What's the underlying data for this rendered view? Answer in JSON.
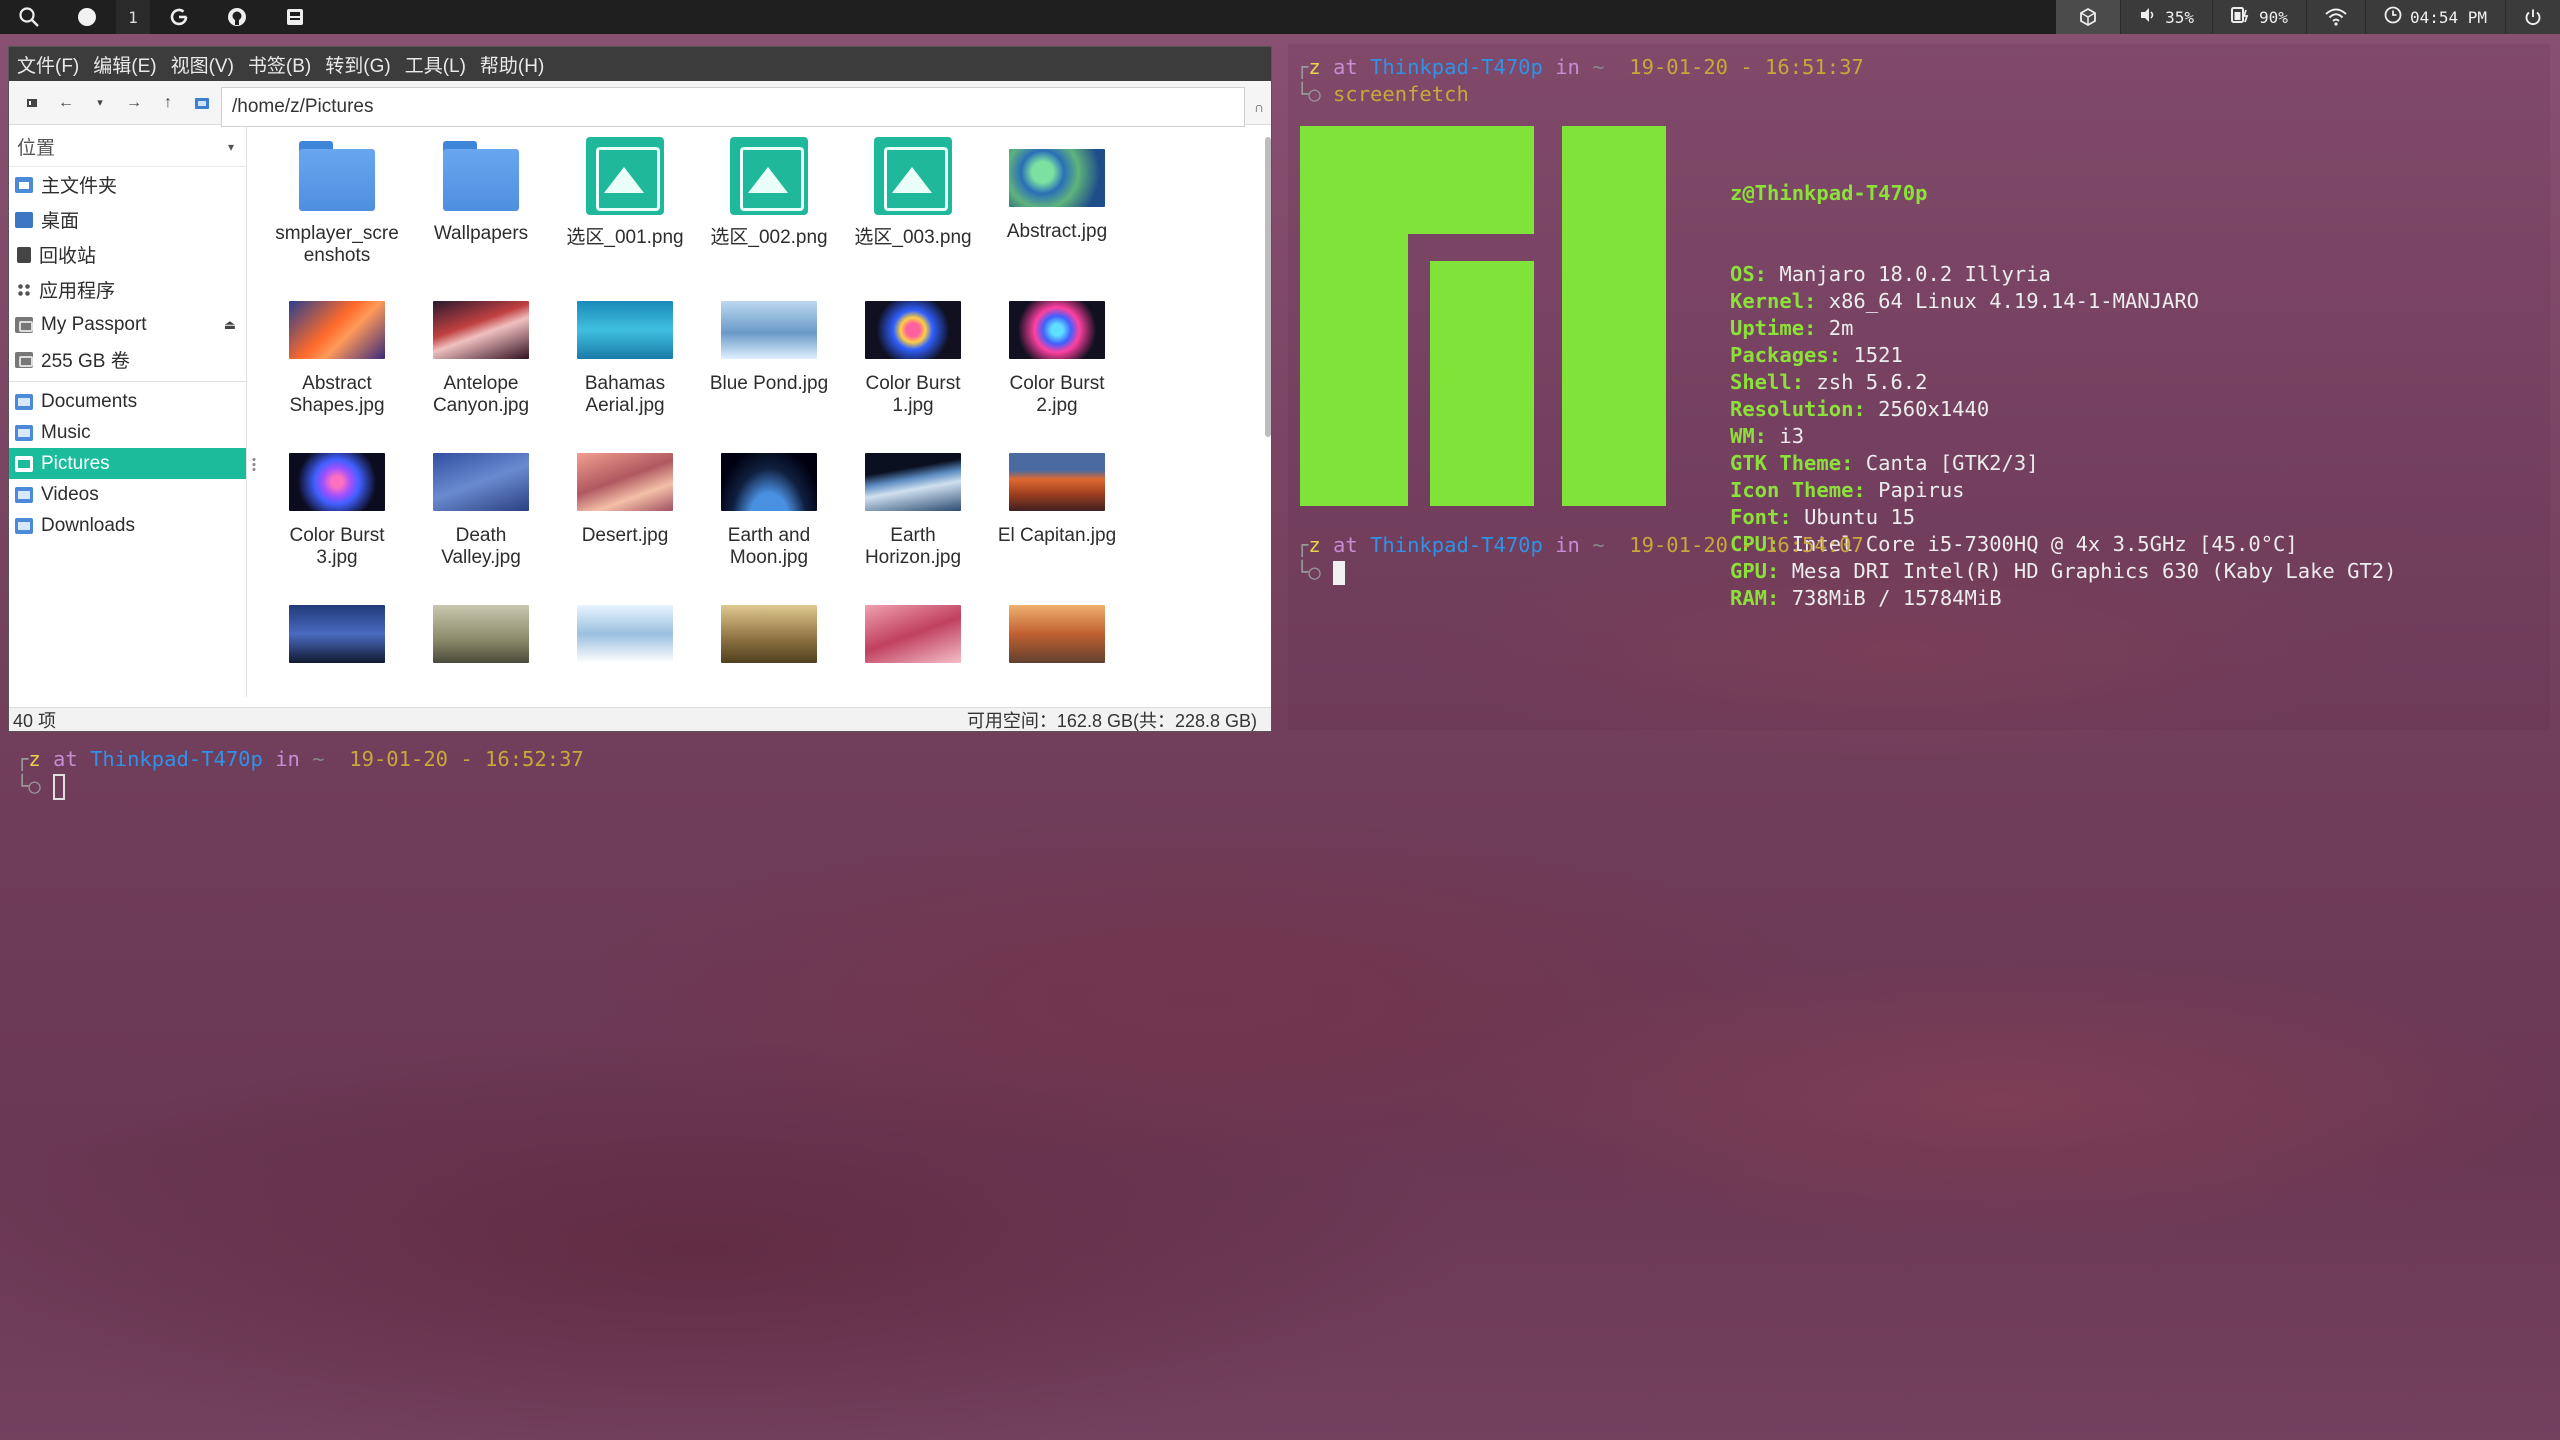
{
  "topbar": {
    "workspace_number": "1",
    "status": {
      "volume": "35%",
      "battery": "90%",
      "clock": "04:54 PM"
    }
  },
  "file_manager": {
    "menus": [
      "文件(F)",
      "编辑(E)",
      "视图(V)",
      "书签(B)",
      "转到(G)",
      "工具(L)",
      "帮助(H)"
    ],
    "path": "/home/z/Pictures",
    "sidebar_header": "位置",
    "places": [
      {
        "label": "主文件夹",
        "icon": "home-icon"
      },
      {
        "label": "桌面",
        "icon": "desktop-icon"
      },
      {
        "label": "回收站",
        "icon": "trash-icon"
      },
      {
        "label": "应用程序",
        "icon": "apps-icon"
      },
      {
        "label": "My Passport",
        "icon": "drive-icon"
      },
      {
        "label": "255 GB 卷",
        "icon": "drive-icon"
      }
    ],
    "bookmarks": [
      {
        "label": "Documents"
      },
      {
        "label": "Music"
      },
      {
        "label": "Pictures"
      },
      {
        "label": "Videos"
      },
      {
        "label": "Downloads"
      }
    ],
    "selected_bookmark": "Pictures",
    "files": [
      {
        "name": "smplayer_scre\nenshots",
        "kind": "folder"
      },
      {
        "name": "Wallpapers",
        "kind": "folder"
      },
      {
        "name": "选区_001.png",
        "kind": "png"
      },
      {
        "name": "选区_002.png",
        "kind": "png"
      },
      {
        "name": "选区_003.png",
        "kind": "png"
      },
      {
        "name": "Abstract.jpg",
        "kind": "img"
      },
      {
        "name": "Abstract\nShapes.jpg",
        "kind": "img"
      },
      {
        "name": "Antelope\nCanyon.jpg",
        "kind": "img"
      },
      {
        "name": "Bahamas\nAerial.jpg",
        "kind": "img"
      },
      {
        "name": "Blue Pond.jpg",
        "kind": "img"
      },
      {
        "name": "Color Burst\n1.jpg",
        "kind": "img"
      },
      {
        "name": "Color Burst\n2.jpg",
        "kind": "img"
      },
      {
        "name": "Color Burst\n3.jpg",
        "kind": "img"
      },
      {
        "name": "Death\nValley.jpg",
        "kind": "img"
      },
      {
        "name": "Desert.jpg",
        "kind": "img"
      },
      {
        "name": "Earth and\nMoon.jpg",
        "kind": "img"
      },
      {
        "name": "Earth\nHorizon.jpg",
        "kind": "img"
      },
      {
        "name": "El Capitan.jpg",
        "kind": "img"
      },
      {
        "name": "",
        "kind": "img"
      },
      {
        "name": "",
        "kind": "img"
      },
      {
        "name": "",
        "kind": "img"
      },
      {
        "name": "",
        "kind": "img"
      },
      {
        "name": "",
        "kind": "img"
      },
      {
        "name": "",
        "kind": "img"
      }
    ],
    "status_count": "40 项",
    "status_space": "可用空间：162.8 GB(共：228.8 GB)"
  },
  "terminal_top": {
    "prompt1": {
      "user": "z",
      "at": "at",
      "host": "Thinkpad-T470p",
      "in": "in",
      "dir": "~",
      "datetime": "19-01-20 - 16:51:37"
    },
    "command": "screenfetch",
    "userhost": "z@Thinkpad-T470p",
    "info": [
      {
        "key": "OS:",
        "value": "Manjaro 18.0.2 Illyria"
      },
      {
        "key": "Kernel:",
        "value": "x86_64 Linux 4.19.14-1-MANJARO"
      },
      {
        "key": "Uptime:",
        "value": "2m"
      },
      {
        "key": "Packages:",
        "value": "1521"
      },
      {
        "key": "Shell:",
        "value": "zsh 5.6.2"
      },
      {
        "key": "Resolution:",
        "value": "2560x1440"
      },
      {
        "key": "WM:",
        "value": "i3"
      },
      {
        "key": "GTK Theme:",
        "value": "Canta [GTK2/3]"
      },
      {
        "key": "Icon Theme:",
        "value": "Papirus"
      },
      {
        "key": "Font:",
        "value": "Ubuntu 15"
      },
      {
        "key": "CPU:",
        "value": "Intel Core i5-7300HQ @ 4x 3.5GHz [45.0°C]"
      },
      {
        "key": "GPU:",
        "value": "Mesa DRI Intel(R) HD Graphics 630 (Kaby Lake GT2)"
      },
      {
        "key": "RAM:",
        "value": "738MiB / 15784MiB"
      }
    ],
    "prompt2": {
      "user": "z",
      "at": "at",
      "host": "Thinkpad-T470p",
      "in": "in",
      "dir": "~",
      "datetime": "19-01-20 - 16:54:07"
    }
  },
  "terminal_bottom": {
    "prompt": {
      "user": "z",
      "at": "at",
      "host": "Thinkpad-T470p",
      "in": "in",
      "dir": "~",
      "datetime": "19-01-20 - 16:52:37"
    }
  },
  "colors": {
    "accent": "#1abc9c",
    "manjaro_green": "#7fe33a",
    "host_blue": "#2f93e8",
    "date_gold": "#c9a73a"
  }
}
